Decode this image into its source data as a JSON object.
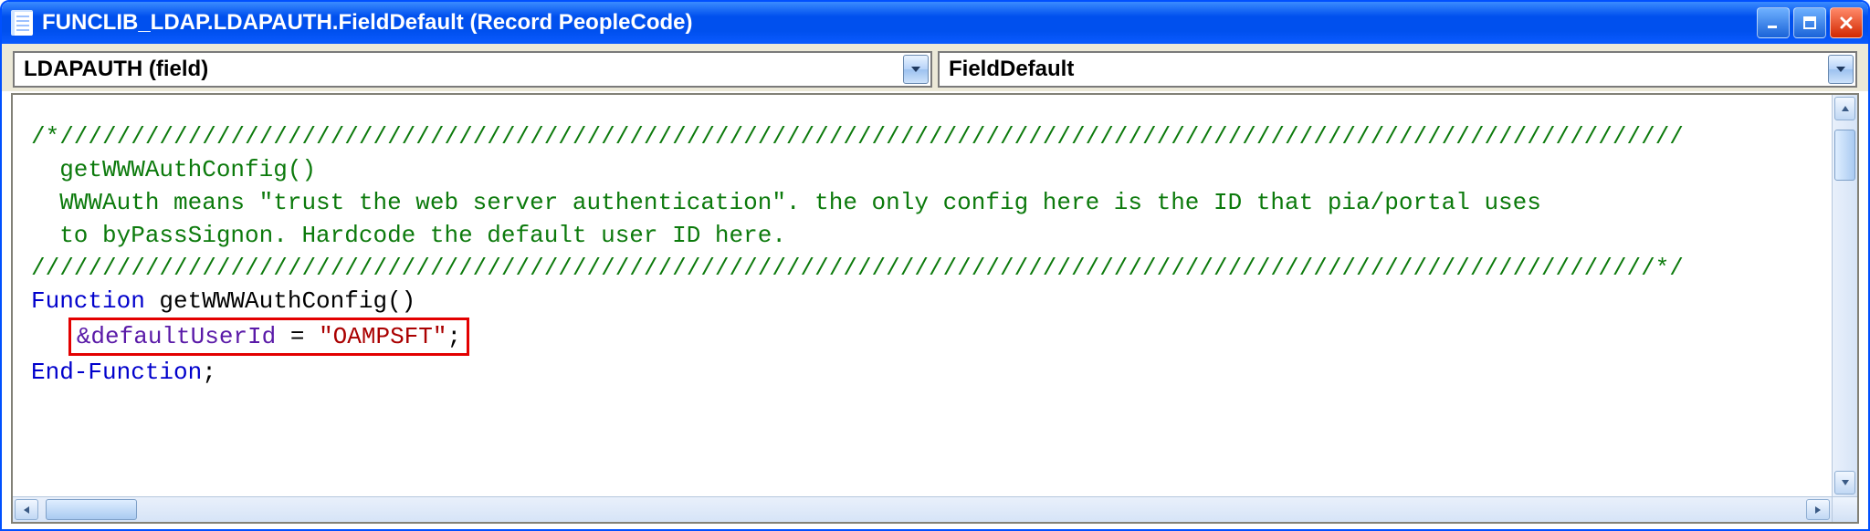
{
  "window": {
    "title": "FUNCLIB_LDAP.LDAPAUTH.FieldDefault (Record PeopleCode)"
  },
  "combos": {
    "field": "LDAPAUTH   (field)",
    "event": "FieldDefault"
  },
  "code": {
    "comment_open": "/*//////////////////////////////////////////////////////////////////////////////////////////////////////////////////",
    "comment_l1": "  getWWWAuthConfig()",
    "comment_l2": "  WWWAuth means \"trust the web server authentication\". the only config here is the ID that pia/portal uses",
    "comment_l3": "  to byPassSignon. Hardcode the default user ID here.",
    "comment_close": "//////////////////////////////////////////////////////////////////////////////////////////////////////////////////*/",
    "kw_function": "Function",
    "fn_name": " getWWWAuthConfig()",
    "indent": "   ",
    "var_name": "&defaultUserId",
    "eq": " = ",
    "string": "\"OAMPSFT\"",
    "semi": ";",
    "kw_endfunction": "End-Function",
    "end_semi": ";"
  }
}
